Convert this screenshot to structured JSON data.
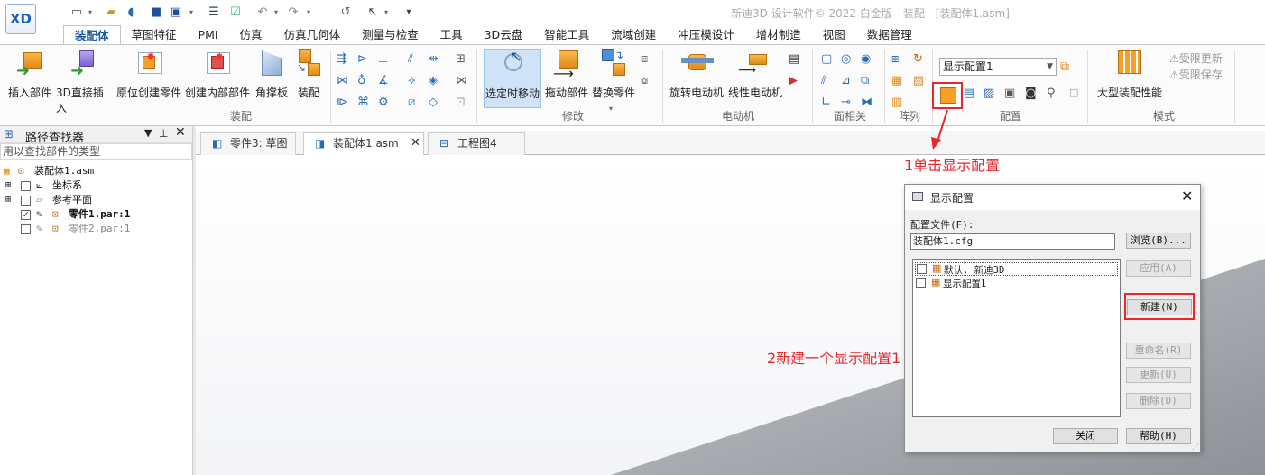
{
  "app": {
    "title": "新迪3D 设计软件© 2022 白金版 - 装配 - [装配体1.asm]",
    "logo": "XD"
  },
  "ribbon": {
    "tabs": [
      "装配体",
      "草图特征",
      "PMI",
      "仿真",
      "仿真几何体",
      "测量与检查",
      "工具",
      "3D云盘",
      "智能工具",
      "流域创建",
      "冲压模设计",
      "增材制造",
      "视图",
      "数据管理"
    ],
    "assembly_group": {
      "label": "装配",
      "buttons": [
        "插入部件",
        "3D直接插入",
        "原位创建零件",
        "创建内部部件",
        "角撑板",
        "装配"
      ]
    },
    "modify_group": {
      "label": "修改",
      "buttons": [
        "选定时移动",
        "拖动部件",
        "替换零件"
      ]
    },
    "motor_group": {
      "label": "电动机",
      "buttons": [
        "旋转电动机",
        "线性电动机"
      ]
    },
    "face_relate_label": "面相关",
    "array_label": "阵列",
    "config_group": {
      "label": "配置",
      "select_value": "显示配置1"
    },
    "mode_group": {
      "label": "模式",
      "large_assembly": "大型装配性能",
      "limited_update": "受限更新",
      "limited_save": "受限保存"
    }
  },
  "pathfinder": {
    "title": "路径查找器",
    "search_placeholder": "用以查找部件的类型",
    "items": [
      {
        "label": "装配体1.asm"
      },
      {
        "label": "坐标系"
      },
      {
        "label": "参考平面"
      },
      {
        "label": "零件1.par:1"
      },
      {
        "label": "零件2.par:1"
      }
    ]
  },
  "doc_tabs": [
    {
      "label": "零件3: 草图"
    },
    {
      "label": "装配体1.asm"
    },
    {
      "label": "工程图4"
    }
  ],
  "annotations": {
    "step1": "1单击显示配置",
    "step2": "2新建一个显示配置1"
  },
  "dialog": {
    "title": "显示配置",
    "file_label": "配置文件(F):",
    "file_value": "装配体1.cfg",
    "browse": "浏览(B)...",
    "list": [
      "默认, 新迪3D",
      "显示配置1"
    ],
    "apply": "应用(A)",
    "new": "新建(N)",
    "rename": "重命名(R)",
    "update": "更新(U)",
    "delete": "删除(D)",
    "close": "关闭",
    "help": "帮助(H)"
  },
  "colors": {
    "accent": "#1a5aa6",
    "annotation": "#e8262b"
  }
}
